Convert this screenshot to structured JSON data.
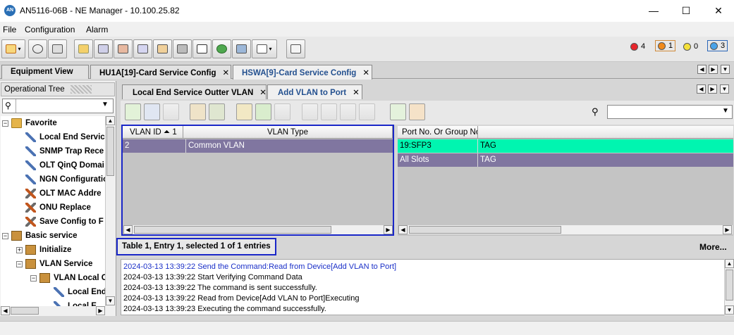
{
  "window": {
    "title": "AN5116-06B - NE Manager - 10.100.25.82",
    "app_icon_text": "AN",
    "minimize": "—",
    "maximize": "☐",
    "close": "✕"
  },
  "menu": [
    "File",
    "Configuration",
    "Alarm"
  ],
  "alarms": [
    {
      "color": "#e8252b",
      "count": "4"
    },
    {
      "color": "#f08a1c",
      "count": "1"
    },
    {
      "color": "#f5e13a",
      "count": "0"
    },
    {
      "color": "#4aa3e8",
      "count": "3"
    }
  ],
  "main_tabs": [
    {
      "label": "Equipment View",
      "closable": false
    },
    {
      "label": "HU1A[19]-Card Service Config",
      "closable": true
    },
    {
      "label": "HSWA[9]-Card Service Config",
      "closable": true,
      "active": true
    }
  ],
  "left": {
    "header": "Operational Tree",
    "tree": [
      {
        "label": "Favorite",
        "icon": "folder-icon",
        "expander": "-"
      },
      {
        "label": "Local End Servic",
        "icon": "wrench-icon"
      },
      {
        "label": "SNMP Trap Rece",
        "icon": "wrench-icon"
      },
      {
        "label": "OLT QinQ Domai",
        "icon": "wrench-icon"
      },
      {
        "label": "NGN Configuratio",
        "icon": "wrench-icon"
      },
      {
        "label": "OLT MAC Addre",
        "icon": "tools-icon"
      },
      {
        "label": "ONU Replace",
        "icon": "tools-icon"
      },
      {
        "label": "Save Config to F",
        "icon": "tools-icon"
      },
      {
        "label": "Basic service",
        "icon": "book-icon",
        "expander": "-"
      },
      {
        "label": "Initialize",
        "icon": "book-icon",
        "expander": "+"
      },
      {
        "label": "VLAN Service",
        "icon": "book-icon",
        "expander": "-"
      },
      {
        "label": "VLAN Local C",
        "icon": "book-icon",
        "expander": "-"
      },
      {
        "label": "Local End",
        "icon": "wrench-icon"
      },
      {
        "label": "Local E",
        "icon": "wrench-icon"
      }
    ]
  },
  "sub_tabs": [
    {
      "label": "Local End Service Outter VLAN"
    },
    {
      "label": "Add VLAN to Port",
      "active": true
    }
  ],
  "table1": {
    "columns": [
      "VLAN ID ⏶ 1",
      "VLAN Type"
    ],
    "rows": [
      [
        "2",
        "Common VLAN"
      ]
    ]
  },
  "table2": {
    "columns": [
      "Port No. Or Group No.",
      ""
    ],
    "rows": [
      [
        "19:SFP3",
        "TAG"
      ],
      [
        "All Slots",
        "TAG"
      ]
    ]
  },
  "status_text": "Table 1, Entry 1, selected 1 of 1 entries",
  "more_label": "More...",
  "log": [
    {
      "text": "2024-03-13 13:39:22 Send the Command:Read from Device[Add VLAN to Port]",
      "color": "#1a2fc8"
    },
    {
      "text": "2024-03-13 13:39:22 Start Verifying Command Data",
      "color": "#000000"
    },
    {
      "text": "2024-03-13 13:39:22 The command is sent successfully.",
      "color": "#000000"
    },
    {
      "text": "2024-03-13 13:39:22 Read from Device[Add VLAN to Port]Executing",
      "color": "#000000"
    },
    {
      "text": "2024-03-13 13:39:23 Executing the command successfully.",
      "color": "#000000"
    }
  ],
  "colors": {
    "selected_row": "#8076a0",
    "highlight_row": "#00f5b0",
    "table_border": "#1a27c8"
  }
}
